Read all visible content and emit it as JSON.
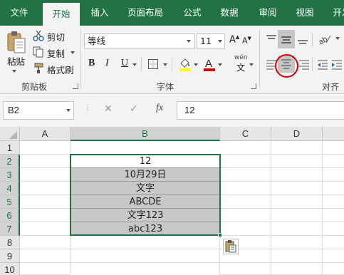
{
  "tabs": [
    "文件",
    "开始",
    "插入",
    "页面布局",
    "公式",
    "数据",
    "审阅",
    "视图",
    "开发"
  ],
  "active_tab": "开始",
  "clipboard": {
    "paste": "粘贴",
    "cut": "剪切",
    "copy": "复制",
    "format_painter": "格式刷",
    "group_label": "剪贴板"
  },
  "font": {
    "family": "等线",
    "size": "11",
    "bold": "B",
    "italic": "I",
    "underline": "U",
    "phonetic": "wén",
    "group_label": "字体"
  },
  "alignment": {
    "group_label": "对齐方"
  },
  "highlight_color": "#d40000",
  "accent_color": "#217346",
  "formula_bar": {
    "name_box": "B2",
    "fx": "fx",
    "value": "12"
  },
  "columns": [
    "A",
    "B",
    "C",
    "D"
  ],
  "rows": [
    "1",
    "2",
    "3",
    "4",
    "5",
    "6",
    "7",
    "8",
    "9",
    "10"
  ],
  "cells_B": [
    "",
    "12",
    "10月29日",
    "文字",
    "ABCDE",
    "文字123",
    "abc123",
    "",
    "",
    ""
  ]
}
